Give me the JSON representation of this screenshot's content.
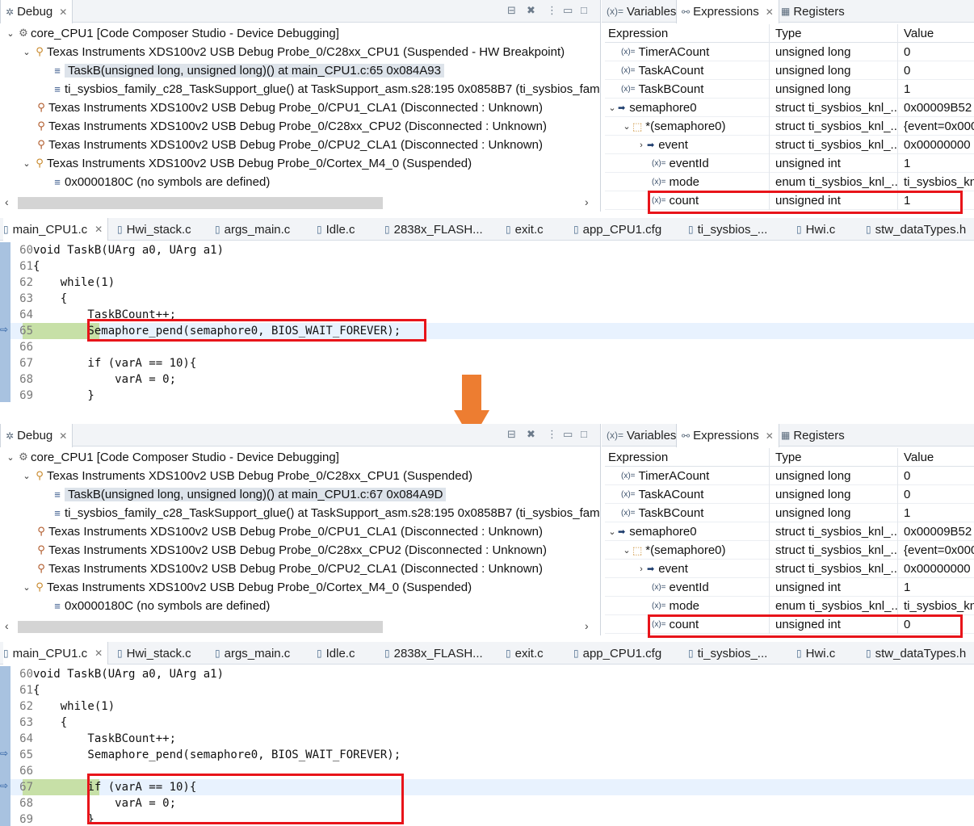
{
  "colors": {
    "highlight_box": "#e8141a",
    "arrow": "#ed7d31",
    "current_line_green": "#c7e0a7"
  },
  "snapshots": [
    {
      "debug_tab": "Debug",
      "tree": [
        {
          "label": "core_CPU1 [Code Composer Studio - Device Debugging]"
        },
        {
          "label": "Texas Instruments XDS100v2 USB Debug Probe_0/C28xx_CPU1 (Suspended - HW Breakpoint)"
        },
        {
          "label": "TaskB(unsigned long, unsigned long)() at main_CPU1.c:65 0x084A93"
        },
        {
          "label": "ti_sysbios_family_c28_TaskSupport_glue() at TaskSupport_asm.s28:195 0x0858B7  (ti_sysbios_family_"
        },
        {
          "label": "Texas Instruments XDS100v2 USB Debug Probe_0/CPU1_CLA1 (Disconnected : Unknown)"
        },
        {
          "label": "Texas Instruments XDS100v2 USB Debug Probe_0/C28xx_CPU2 (Disconnected : Unknown)"
        },
        {
          "label": "Texas Instruments XDS100v2 USB Debug Probe_0/CPU2_CLA1 (Disconnected : Unknown)"
        },
        {
          "label": "Texas Instruments XDS100v2 USB Debug Probe_0/Cortex_M4_0 (Suspended)"
        },
        {
          "label": "0x0000180C  (no symbols are defined)"
        }
      ],
      "expr_tabs": [
        "Variables",
        "Expressions",
        "Registers"
      ],
      "expr_headers": [
        "Expression",
        "Type",
        "Value"
      ],
      "expr_rows": [
        {
          "name": "TimerACount",
          "type": "unsigned long",
          "value": "0"
        },
        {
          "name": "TaskACount",
          "type": "unsigned long",
          "value": "0"
        },
        {
          "name": "TaskBCount",
          "type": "unsigned long",
          "value": "1"
        },
        {
          "name": "semaphore0",
          "type": "struct ti_sysbios_knl_...",
          "value": "0x00009B52"
        },
        {
          "name": "*(semaphore0)",
          "type": "struct ti_sysbios_knl_...",
          "value": "{event=0x000"
        },
        {
          "name": "event",
          "type": "struct ti_sysbios_knl_...",
          "value": "0x00000000"
        },
        {
          "name": "eventId",
          "type": "unsigned int",
          "value": "1"
        },
        {
          "name": "mode",
          "type": "enum ti_sysbios_knl_...",
          "value": "ti_sysbios_kn"
        },
        {
          "name": "count",
          "type": "unsigned int",
          "value": "1"
        }
      ],
      "file_tabs": [
        "main_CPU1.c",
        "Hwi_stack.c",
        "args_main.c",
        "Idle.c",
        "2838x_FLASH...",
        "exit.c",
        "app_CPU1.cfg",
        "ti_sysbios_...",
        "Hwi.c",
        "stw_dataTypes.h"
      ],
      "code": [
        {
          "n": "60",
          "text": "void TaskB(UArg a0, UArg a1)"
        },
        {
          "n": "61",
          "text": "{"
        },
        {
          "n": "62",
          "text": "    while(1)"
        },
        {
          "n": "63",
          "text": "    {"
        },
        {
          "n": "64",
          "text": "        TaskBCount++;"
        },
        {
          "n": "65",
          "text": "        Semaphore_pend(semaphore0, BIOS_WAIT_FOREVER);"
        },
        {
          "n": "66",
          "text": ""
        },
        {
          "n": "67",
          "text": "        if (varA == 10){"
        },
        {
          "n": "68",
          "text": "            varA = 0;"
        },
        {
          "n": "69",
          "text": "        }"
        }
      ]
    },
    {
      "debug_tab": "Debug",
      "tree": [
        {
          "label": "core_CPU1 [Code Composer Studio - Device Debugging]"
        },
        {
          "label": "Texas Instruments XDS100v2 USB Debug Probe_0/C28xx_CPU1 (Suspended)"
        },
        {
          "label": "TaskB(unsigned long, unsigned long)() at main_CPU1.c:67 0x084A9D"
        },
        {
          "label": "ti_sysbios_family_c28_TaskSupport_glue() at TaskSupport_asm.s28:195 0x0858B7  (ti_sysbios_family_"
        },
        {
          "label": "Texas Instruments XDS100v2 USB Debug Probe_0/CPU1_CLA1 (Disconnected : Unknown)"
        },
        {
          "label": "Texas Instruments XDS100v2 USB Debug Probe_0/C28xx_CPU2 (Disconnected : Unknown)"
        },
        {
          "label": "Texas Instruments XDS100v2 USB Debug Probe_0/CPU2_CLA1 (Disconnected : Unknown)"
        },
        {
          "label": "Texas Instruments XDS100v2 USB Debug Probe_0/Cortex_M4_0 (Suspended)"
        },
        {
          "label": "0x0000180C  (no symbols are defined)"
        }
      ],
      "expr_tabs": [
        "Variables",
        "Expressions",
        "Registers"
      ],
      "expr_headers": [
        "Expression",
        "Type",
        "Value"
      ],
      "expr_rows": [
        {
          "name": "TimerACount",
          "type": "unsigned long",
          "value": "0"
        },
        {
          "name": "TaskACount",
          "type": "unsigned long",
          "value": "0"
        },
        {
          "name": "TaskBCount",
          "type": "unsigned long",
          "value": "1"
        },
        {
          "name": "semaphore0",
          "type": "struct ti_sysbios_knl_...",
          "value": "0x00009B52"
        },
        {
          "name": "*(semaphore0)",
          "type": "struct ti_sysbios_knl_...",
          "value": "{event=0x000"
        },
        {
          "name": "event",
          "type": "struct ti_sysbios_knl_...",
          "value": "0x00000000"
        },
        {
          "name": "eventId",
          "type": "unsigned int",
          "value": "1"
        },
        {
          "name": "mode",
          "type": "enum ti_sysbios_knl_...",
          "value": "ti_sysbios_kn"
        },
        {
          "name": "count",
          "type": "unsigned int",
          "value": "0"
        }
      ],
      "file_tabs": [
        "main_CPU1.c",
        "Hwi_stack.c",
        "args_main.c",
        "Idle.c",
        "2838x_FLASH...",
        "exit.c",
        "app_CPU1.cfg",
        "ti_sysbios_...",
        "Hwi.c",
        "stw_dataTypes.h"
      ],
      "code": [
        {
          "n": "60",
          "text": "void TaskB(UArg a0, UArg a1)"
        },
        {
          "n": "61",
          "text": "{"
        },
        {
          "n": "62",
          "text": "    while(1)"
        },
        {
          "n": "63",
          "text": "    {"
        },
        {
          "n": "64",
          "text": "        TaskBCount++;"
        },
        {
          "n": "65",
          "text": "        Semaphore_pend(semaphore0, BIOS_WAIT_FOREVER);"
        },
        {
          "n": "66",
          "text": ""
        },
        {
          "n": "67",
          "text": "        if (varA == 10){"
        },
        {
          "n": "68",
          "text": "            varA = 0;"
        },
        {
          "n": "69",
          "text": "        }"
        }
      ]
    }
  ]
}
